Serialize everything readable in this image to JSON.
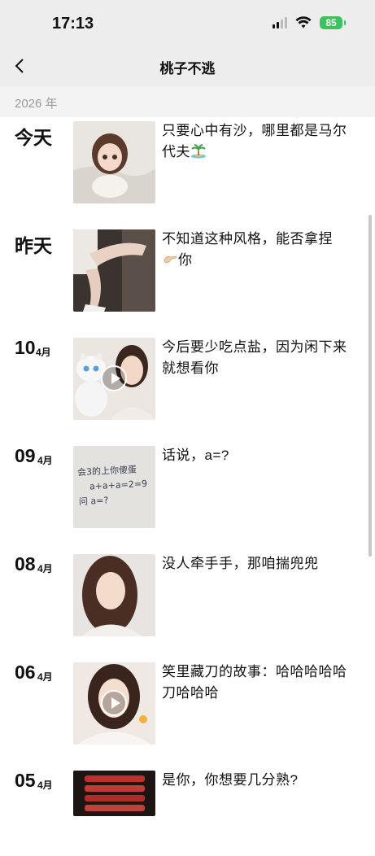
{
  "status_bar": {
    "time": "17:13",
    "battery": "85",
    "icons": [
      "signal-icon",
      "wifi-icon",
      "battery-icon"
    ]
  },
  "nav": {
    "title": "桃子不逃",
    "back_icon": "chevron-left-icon"
  },
  "year": "2026 年",
  "posts": [
    {
      "date": "今天",
      "text": "只要心中有沙，哪里都是马尔代夫",
      "emoji": "island-icon",
      "video": false
    },
    {
      "date": "昨天",
      "text": "不知道这种风格，能否拿捏",
      "emoji": "pinching-hand-icon",
      "text_after_emoji": "你",
      "video": false
    },
    {
      "day": "10",
      "month": "4月",
      "text": "今后要少吃点盐，因为闲下来就想看你",
      "video": true
    },
    {
      "day": "09",
      "month": "4月",
      "text": "话说，a=?",
      "video": false,
      "thumb_lines": [
        "会3的上你傻蛋",
        "a+a+a=2=9",
        "问 a=?"
      ]
    },
    {
      "day": "08",
      "month": "4月",
      "text": "没人牵手手，那咱揣兜兜",
      "video": false
    },
    {
      "day": "06",
      "month": "4月",
      "text": "笑里藏刀的故事：哈哈哈哈哈刀哈哈哈",
      "video": true
    },
    {
      "day": "05",
      "month": "4月",
      "text": "是你，你想要几分熟?",
      "video": false
    }
  ],
  "colors": {
    "header_bg": "#ededed",
    "year_bg": "#f3f3f3",
    "battery": "#3cc35f",
    "year_text": "#9a9a9a"
  }
}
